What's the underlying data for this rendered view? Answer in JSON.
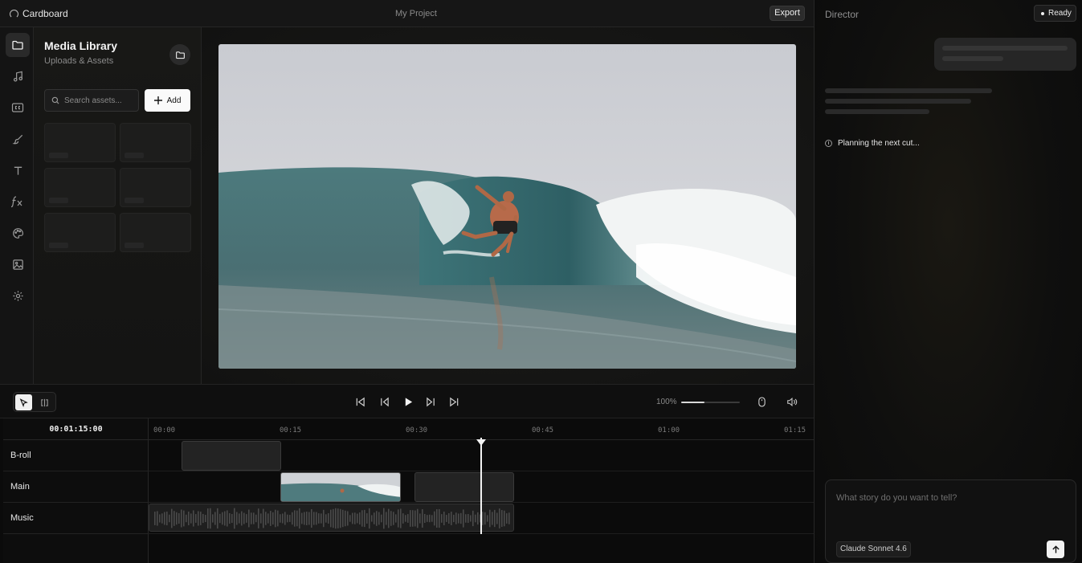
{
  "app": {
    "brand": "Cardboard",
    "project_title": "My Project",
    "export_label": "Export"
  },
  "rail": {
    "items": [
      {
        "icon": "folder-icon",
        "active": true
      },
      {
        "icon": "music-icon",
        "active": false
      },
      {
        "icon": "captions-icon",
        "active": false
      },
      {
        "icon": "brush-icon",
        "active": false
      },
      {
        "icon": "text-icon",
        "active": false
      },
      {
        "icon": "effects-icon",
        "active": false
      },
      {
        "icon": "palette-icon",
        "active": false
      },
      {
        "icon": "image-icon",
        "active": false
      },
      {
        "icon": "settings-icon",
        "active": false
      }
    ]
  },
  "library": {
    "title": "Media Library",
    "subtitle": "Uploads & Assets",
    "search_placeholder": "Search assets...",
    "add_label": "Add",
    "asset_count": 6
  },
  "transport": {
    "zoom_label": "100%",
    "zoom_level": 0.4,
    "icons": [
      "skip-back-icon",
      "step-back-icon",
      "play-icon",
      "step-forward-icon",
      "skip-forward-icon",
      "mouse-icon",
      "volume-icon"
    ]
  },
  "timeline": {
    "timecode": "00:01:15:00",
    "ruler_ticks": [
      "00:00",
      "00:15",
      "00:30",
      "00:45",
      "01:00",
      "01:15"
    ],
    "tracks": [
      {
        "name": "B-roll"
      },
      {
        "name": "Main"
      },
      {
        "name": "Music"
      }
    ]
  },
  "director": {
    "title": "Director",
    "status": "Ready",
    "thinking_text": "Planning the next cut...",
    "prompt_placeholder": "What story do you want to tell?",
    "model": "Claude Sonnet 4.6"
  }
}
